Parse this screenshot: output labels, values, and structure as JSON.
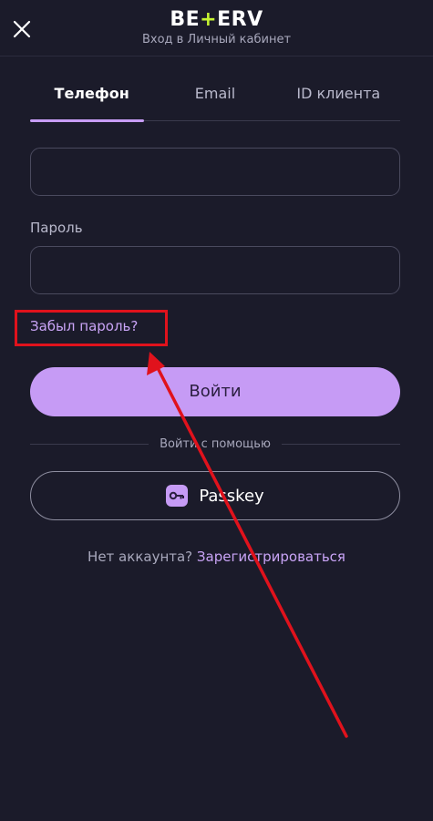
{
  "header": {
    "logo_left": "BE",
    "logo_plus": "+",
    "logo_right": "ERV",
    "subtitle": "Вход в Личный кабинет"
  },
  "tabs": [
    {
      "label": "Телефон",
      "active": true
    },
    {
      "label": "Email",
      "active": false
    },
    {
      "label": "ID клиента",
      "active": false
    }
  ],
  "form": {
    "phone_value": "",
    "password_label": "Пароль",
    "password_value": "",
    "forgot_label": "Забыл пароль?",
    "login_label": "Войти",
    "divider_text": "Войти с помощью",
    "passkey_label": "Passkey"
  },
  "signup": {
    "question": "Нет аккаунта?",
    "link": "Зарегистрироваться"
  },
  "colors": {
    "background": "#1b1b2a",
    "accent": "#c69bf5",
    "link": "#c9a4f6",
    "logo_plus": "#c6f432",
    "annotation": "#e0121c"
  },
  "icons": {
    "close": "close-icon",
    "passkey": "key-icon"
  }
}
